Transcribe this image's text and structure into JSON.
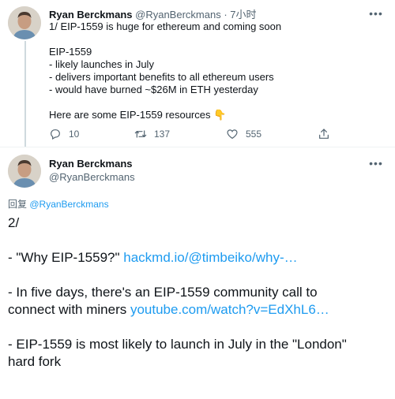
{
  "tweet1": {
    "author_name": "Ryan Berckmans",
    "author_handle": "@RyanBerckmans",
    "separator": "·",
    "time": "7小时",
    "more_icon": "ellipsis-icon",
    "lines": [
      "1/ EIP-1559 is huge for ethereum and coming soon",
      "EIP-1559",
      "- likely launches in July",
      "- delivers important benefits to all ethereum users",
      "- would have burned ~$26M in ETH yesterday",
      "Here are some EIP-1559 resources"
    ],
    "emoji": "👇",
    "actions": {
      "reply_count": "10",
      "retweet_count": "137",
      "like_count": "555"
    }
  },
  "tweet2": {
    "author_name": "Ryan Berckmans",
    "author_handle": "@RyanBerckmans",
    "reply_prefix": "回复",
    "reply_handle": "@RyanBerckmans",
    "body": {
      "l1": "2/",
      "l2_text": "- \"Why EIP-1559?\" ",
      "l2_link": "hackmd.io/@timbeiko/why-…",
      "l3": "- In five days, there's an EIP-1559 community call to",
      "l4_text": "connect with miners ",
      "l4_link": "youtube.com/watch?v=EdXhL6…",
      "l5": "- EIP-1559 is most likely to launch in July in the \"London\"",
      "l6": "hard fork"
    }
  },
  "colors": {
    "link": "#1d9bf0",
    "muted": "#536471",
    "text": "#0f1419",
    "thread_line": "#cfd9de"
  }
}
